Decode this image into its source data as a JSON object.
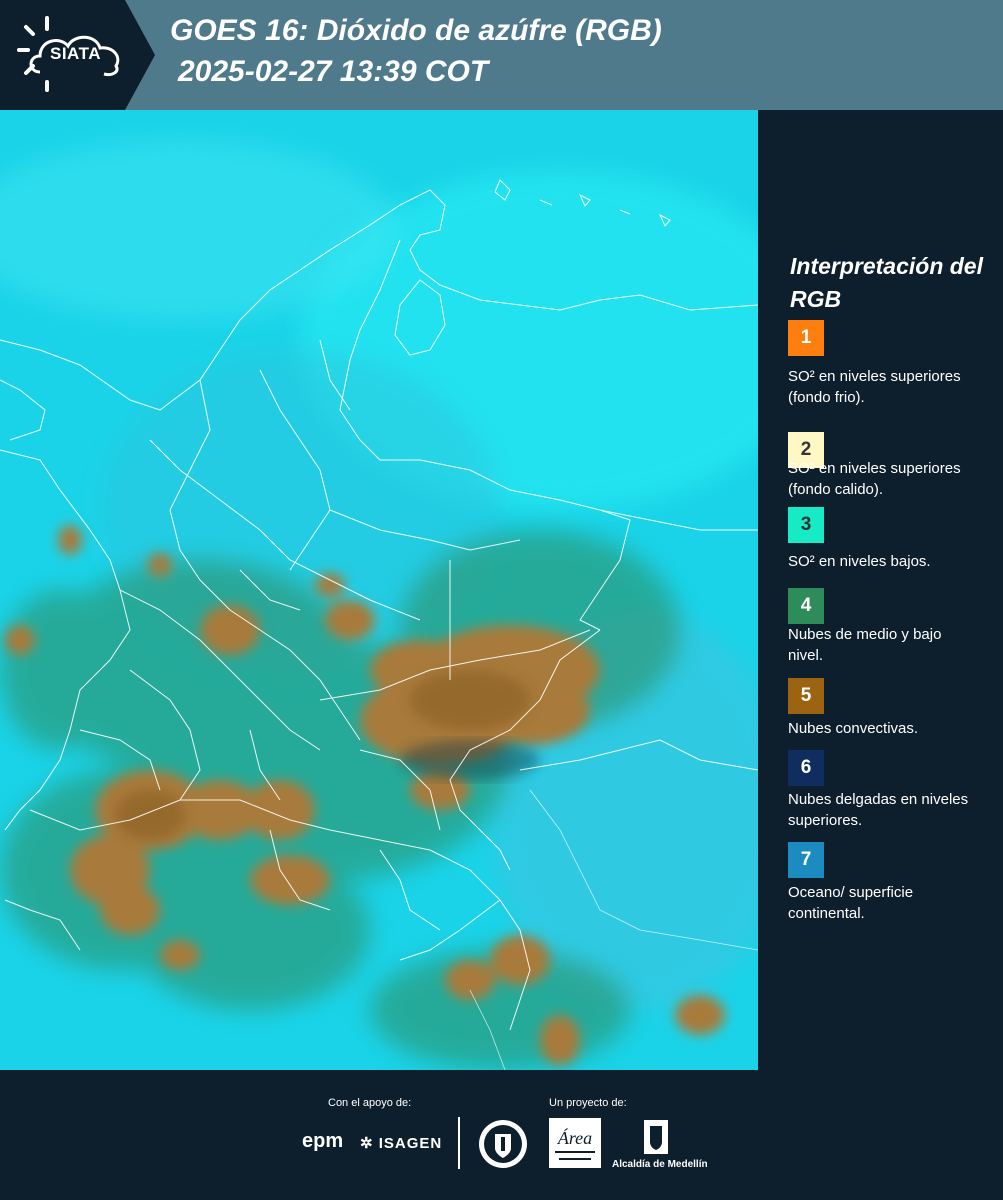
{
  "header": {
    "logo_text": "SIATA",
    "title_line1": "GOES 16: Dióxido de azúfre (RGB)",
    "title_line2": "2025-02-27 13:39 COT"
  },
  "legend": {
    "title": "Interpretación del RGB",
    "items": [
      {
        "number": "1",
        "color": "#ff7f0e",
        "text_color": "#ffffff",
        "label": "SO² en niveles superiores (fondo frio)."
      },
      {
        "number": "2",
        "color": "#fff8c4",
        "text_color": "#333333",
        "label": "SO² en niveles superiores (fondo calido)."
      },
      {
        "number": "3",
        "color": "#17ebc5",
        "text_color": "#333333",
        "label": "SO² en niveles bajos."
      },
      {
        "number": "4",
        "color": "#2e8b5a",
        "text_color": "#ffffff",
        "label": "Nubes de medio y bajo nivel."
      },
      {
        "number": "5",
        "color": "#9c6410",
        "text_color": "#ffffff",
        "label": "Nubes convectivas."
      },
      {
        "number": "6",
        "color": "#0f2e5f",
        "text_color": "#ffffff",
        "label": "Nubes delgadas en niveles superiores."
      },
      {
        "number": "7",
        "color": "#1c8cc0",
        "text_color": "#ffffff",
        "label": "Oceano/ superficie continental."
      }
    ]
  },
  "footer": {
    "support_label": "Con el apoyo de:",
    "project_label": "Un proyecto de:",
    "sponsors": [
      "epm",
      "ISAGEN"
    ],
    "partners": [
      "Área Metropolitana Valle de Aburrá",
      "Alcaldía de Medellín"
    ],
    "alcaldia_text": "Alcaldía de Medellín"
  }
}
